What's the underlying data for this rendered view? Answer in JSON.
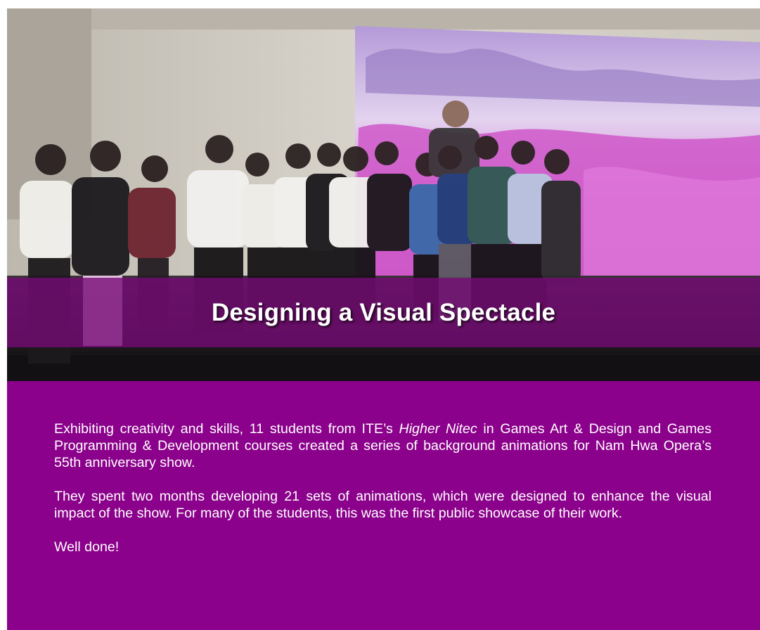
{
  "banner": {
    "title": "Designing a Visual Spectacle"
  },
  "article": {
    "p1_before": "Exhibiting creativity and skills, 11 students from ITE’s ",
    "p1_italic": "Higher Nitec",
    "p1_after": " in Games Art & Design and Games Programming & Development courses created a series of background animations for Nam Hwa Opera’s 55th anniversary show.",
    "p2": "They spent two months developing 21 sets of animations, which were designed to enhance the visual impact of the show. For many of the students, this was the first public showcase of their work.",
    "p3": "Well done!"
  },
  "colors": {
    "panel": "#8b018b",
    "banner": "#760a76",
    "text": "#ffffff"
  }
}
